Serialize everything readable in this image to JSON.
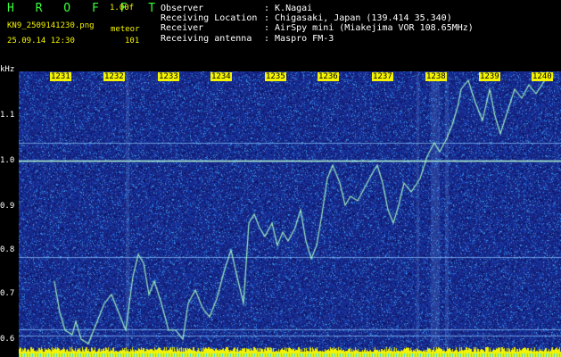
{
  "header": {
    "brand": "H R O F F T",
    "version": "1.00f",
    "filename": "KN9_2509141230.png",
    "meteor_label": "meteor",
    "datetime": "25.09.14 12:30",
    "meteor_count": "101"
  },
  "meta": [
    {
      "key": "Observer",
      "value": ": K.Nagai"
    },
    {
      "key": "Receiving Location",
      "value": ": Chigasaki, Japan (139.414 35.340)"
    },
    {
      "key": "Receiver",
      "value": ": AirSpy mini (Miakejima VOR 108.65MHz)"
    },
    {
      "key": "Receiving antenna",
      "value": ": Maspro FM-3"
    }
  ],
  "axis": {
    "y_unit": "kHz",
    "y_ticks": [
      "1.1",
      "1.0",
      "0.9",
      "0.8",
      "0.7",
      "0.6"
    ],
    "x_ticks": [
      "1231",
      "1232",
      "1233",
      "1234",
      "1235",
      "1236",
      "1237",
      "1238",
      "1239",
      "1240"
    ]
  },
  "colors": {
    "background": "#1a2a8c",
    "trace": "#9ef0c0",
    "carrier": "#b8ffd8",
    "label_bg": "#f4f400",
    "baseline": "#f4f400"
  }
}
